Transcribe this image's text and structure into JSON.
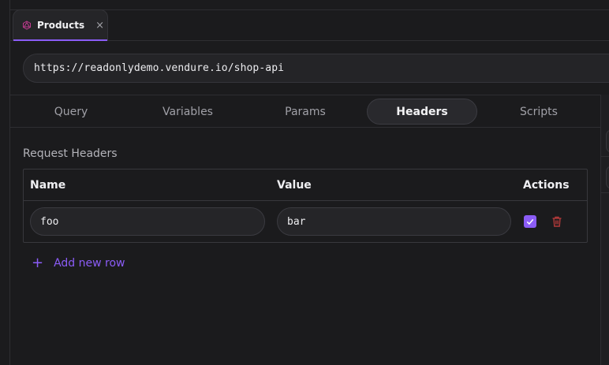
{
  "tabs": [
    {
      "label": "Products",
      "icon": "graphql-icon",
      "active": true
    }
  ],
  "url": "https://readonlydemo.vendure.io/shop-api",
  "subtabs": [
    {
      "label": "Query"
    },
    {
      "label": "Variables"
    },
    {
      "label": "Params"
    },
    {
      "label": "Headers",
      "active": true
    },
    {
      "label": "Scripts"
    }
  ],
  "headers_section": {
    "title": "Request Headers",
    "columns": {
      "name": "Name",
      "value": "Value",
      "actions": "Actions"
    },
    "rows": [
      {
        "name": "foo",
        "value": "bar",
        "enabled": true
      }
    ],
    "add_row_label": "Add new row"
  },
  "colors": {
    "accent": "#8b5cf6",
    "background": "#1b1b1d",
    "danger": "#b33a3a"
  }
}
